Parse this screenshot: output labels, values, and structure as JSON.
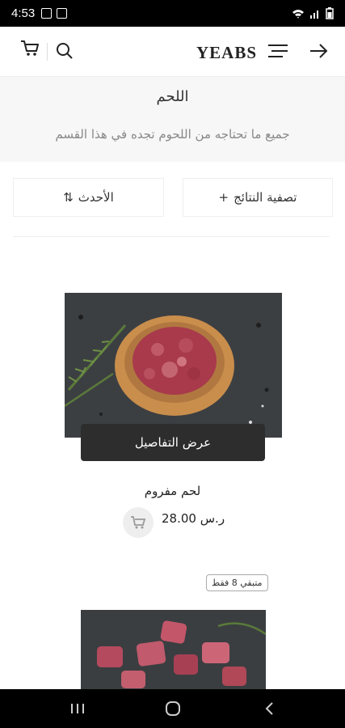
{
  "status_bar": {
    "time": "4:53"
  },
  "app_bar": {
    "logo": "YEABS"
  },
  "category": {
    "title": "اللحم",
    "subtitle": "جميع ما تحتاجه من اللحوم تجده في هذا القسم"
  },
  "filters": {
    "filter_label": "تصفية النتائج",
    "filter_icon": "+",
    "sort_label": "الأحدث",
    "sort_icon": "⇅"
  },
  "products": [
    {
      "name": "لحم مفروم",
      "price": "28.00",
      "currency": "ر.س",
      "details_label": "عرض التفاصيل"
    },
    {
      "stock_badge": "متبقي 8 فقط"
    }
  ],
  "icons": {
    "cart": "cart-icon",
    "search": "search-icon",
    "menu": "menu-icon",
    "back": "arrow-right-icon",
    "add_to_cart": "cart-add-icon"
  }
}
